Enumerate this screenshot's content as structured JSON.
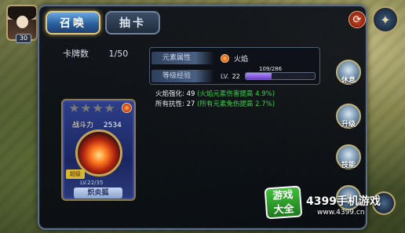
{
  "player": {
    "level": "30"
  },
  "tabs": [
    {
      "label": "召唤",
      "active": true
    },
    {
      "label": "抽卡",
      "active": false
    }
  ],
  "card_count": {
    "label": "卡牌数",
    "value": "1/50"
  },
  "card": {
    "stars": 4,
    "power_label": "战斗力",
    "power_value": "2534",
    "tag": "超级",
    "level": "LV.22/35",
    "name": "炽炎狐"
  },
  "attributes": {
    "element_label": "元素属性",
    "element_value": "火焰",
    "xp_label": "等级经验",
    "lv_prefix": "LV.",
    "lv_value": "22",
    "xp_text": "109/286",
    "xp_progress": 0.381
  },
  "stats": [
    {
      "label": "火焰强化:",
      "value": "49",
      "note": "(火焰元素伤害提高 4.9%)"
    },
    {
      "label": "所有抗性:",
      "value": "27",
      "note": "(所有元素免伤提高 2.7%)"
    }
  ],
  "side_buttons": [
    {
      "label": "休息"
    },
    {
      "label": "升级"
    },
    {
      "label": "技能"
    },
    {
      "label": ""
    }
  ],
  "watermark": {
    "logo_line1": "游戏",
    "logo_line2": "大全",
    "site": "4399手机游戏",
    "url": "www.4399.cn"
  },
  "colors": {
    "accent_gold": "#e1c87a",
    "highlight_green": "#39d24a",
    "xp_purple": "#8a5ae0"
  }
}
